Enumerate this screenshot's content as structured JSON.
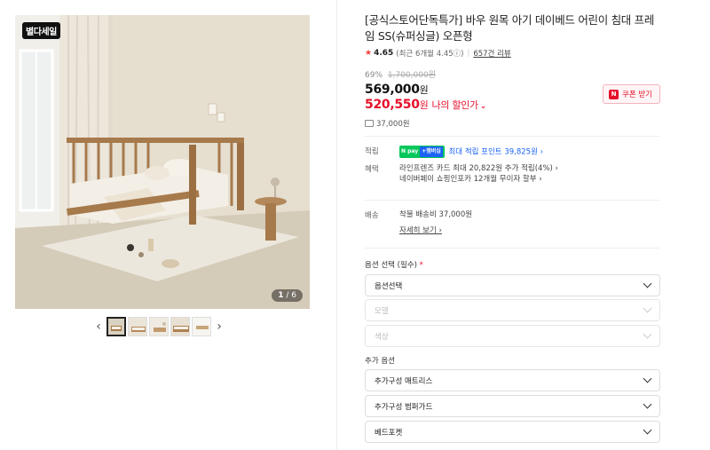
{
  "gallery": {
    "badge": "별다세일",
    "page_current": "1",
    "page_total": "/ 6",
    "prev_arrow": "‹",
    "next_arrow": "›",
    "thumb_count": 5
  },
  "product": {
    "title": "[공식스토어단독특가] 바우 원목 아기 데이베드 어린이 침대 프레임 SS(슈퍼싱글) 오픈형",
    "rating": "4.65",
    "rating_recent": "(최근 6개월 4.45ⓘ)",
    "review_link": "657건 리뷰",
    "discount_pct": "69%",
    "original_price": "1,700,000원",
    "price": "569,000",
    "price_unit": "원",
    "my_price": "520,550",
    "my_price_unit": "원",
    "my_price_label": "나의 할인가",
    "coupon_button": "쿠폰 받기",
    "point_text": "37,000원"
  },
  "benefits": {
    "point_label": "적립",
    "point_badge": "N pay",
    "point_badge_plus": "+멤버십",
    "point_max": "최대 적립 포인트 39,825원 ›",
    "benefit_label": "혜택",
    "benefit_line1": "라인프렌즈 카드 최대 20,822원 추가 적립(4%) ›",
    "benefit_line2": "네이버페이 쇼핑인포카 12개월 무이자 할부 ›"
  },
  "shipping": {
    "label": "배송",
    "text": "착불 배송비 37,000원",
    "detail_link": "자세히 보기 ›"
  },
  "options": {
    "required_label": "옵션 선택 (필수)",
    "required_star": "*",
    "select_main": "옵션선택",
    "select_model": "모델",
    "select_color": "색상",
    "extra_label": "추가 옵션",
    "extra_1": "추가구성 매트리스",
    "extra_2": "추가구성 범퍼가드",
    "extra_3": "베드포켓"
  },
  "colors": {
    "accent_red": "#e5112b",
    "link_blue": "#1a63f5",
    "npay_green": "#03c75a"
  }
}
